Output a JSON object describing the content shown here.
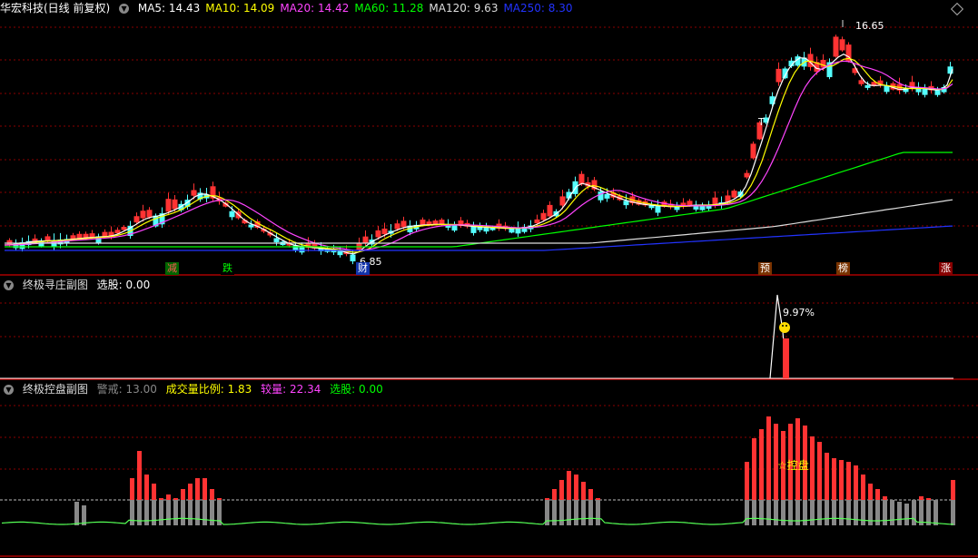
{
  "main_panel": {
    "title": "华宏科技(日线 前复权)",
    "ma": [
      {
        "label": "MA5: 14.43",
        "color": "#ffffff"
      },
      {
        "label": "MA10: 14.09",
        "color": "#ffff00"
      },
      {
        "label": "MA20: 14.42",
        "color": "#ff44ff"
      },
      {
        "label": "MA60: 11.28",
        "color": "#00ff00"
      },
      {
        "label": "MA120: 9.63",
        "color": "#dddddd"
      },
      {
        "label": "MA250: 8.30",
        "color": "#2233ff"
      }
    ],
    "high_label": "16.65",
    "low_label": "6.85",
    "up_marker": "T",
    "signals": [
      {
        "text": "减",
        "bg": "#006600",
        "fg": "#ff5555"
      },
      {
        "text": "跌",
        "bg": "#000000",
        "fg": "#00ff00"
      },
      {
        "text": "财",
        "bg": "#1133aa",
        "fg": "#ffffff"
      },
      {
        "text": "预",
        "bg": "#7a3300",
        "fg": "#ffffff"
      },
      {
        "text": "榜",
        "bg": "#7a3300",
        "fg": "#ffffff"
      },
      {
        "text": "涨",
        "bg": "#880000",
        "fg": "#ffffff"
      }
    ]
  },
  "sub1": {
    "title": "终极寻庄副图",
    "value": "选股: 0.00",
    "pct_label": "9.97%",
    "smile_icon": "smiley-icon"
  },
  "sub2": {
    "title": "终极控盘副图",
    "warn": "警戒: 13.00",
    "ratio": "成交量比例: 1.83",
    "vol": "较量: 22.34",
    "pick": "选股: 0.00",
    "control_label": "☆控盘"
  },
  "colors": {
    "up": "#ff3333",
    "down": "#54ffff",
    "grid": "#8b0000",
    "border": "#ff0000"
  },
  "chart_data": {
    "type": "candlestick",
    "y_labels": [
      "16.65",
      "6.85"
    ],
    "volume_bars": "red above threshold, gray below"
  }
}
